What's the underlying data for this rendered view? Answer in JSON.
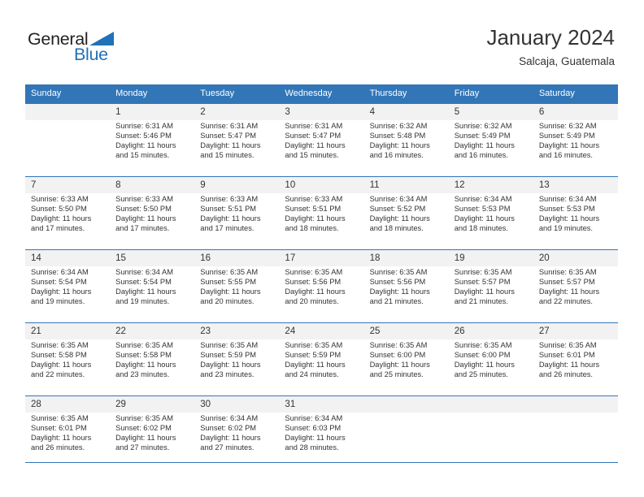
{
  "brand": {
    "name_top": "General",
    "name_bottom": "Blue",
    "accent_color": "#1f72b8"
  },
  "header": {
    "title": "January 2024",
    "subtitle": "Salcaja, Guatemala"
  },
  "calendar": {
    "header_bg": "#3276b8",
    "weekday_headers": [
      "Sunday",
      "Monday",
      "Tuesday",
      "Wednesday",
      "Thursday",
      "Friday",
      "Saturday"
    ],
    "weeks": [
      [
        {
          "day": "",
          "sunrise": "",
          "sunset": "",
          "daylight_line1": "",
          "daylight_line2": "",
          "empty": true
        },
        {
          "day": "1",
          "sunrise": "Sunrise: 6:31 AM",
          "sunset": "Sunset: 5:46 PM",
          "daylight_line1": "Daylight: 11 hours",
          "daylight_line2": "and 15 minutes.",
          "empty": false
        },
        {
          "day": "2",
          "sunrise": "Sunrise: 6:31 AM",
          "sunset": "Sunset: 5:47 PM",
          "daylight_line1": "Daylight: 11 hours",
          "daylight_line2": "and 15 minutes.",
          "empty": false
        },
        {
          "day": "3",
          "sunrise": "Sunrise: 6:31 AM",
          "sunset": "Sunset: 5:47 PM",
          "daylight_line1": "Daylight: 11 hours",
          "daylight_line2": "and 15 minutes.",
          "empty": false
        },
        {
          "day": "4",
          "sunrise": "Sunrise: 6:32 AM",
          "sunset": "Sunset: 5:48 PM",
          "daylight_line1": "Daylight: 11 hours",
          "daylight_line2": "and 16 minutes.",
          "empty": false
        },
        {
          "day": "5",
          "sunrise": "Sunrise: 6:32 AM",
          "sunset": "Sunset: 5:49 PM",
          "daylight_line1": "Daylight: 11 hours",
          "daylight_line2": "and 16 minutes.",
          "empty": false
        },
        {
          "day": "6",
          "sunrise": "Sunrise: 6:32 AM",
          "sunset": "Sunset: 5:49 PM",
          "daylight_line1": "Daylight: 11 hours",
          "daylight_line2": "and 16 minutes.",
          "empty": false
        }
      ],
      [
        {
          "day": "7",
          "sunrise": "Sunrise: 6:33 AM",
          "sunset": "Sunset: 5:50 PM",
          "daylight_line1": "Daylight: 11 hours",
          "daylight_line2": "and 17 minutes.",
          "empty": false
        },
        {
          "day": "8",
          "sunrise": "Sunrise: 6:33 AM",
          "sunset": "Sunset: 5:50 PM",
          "daylight_line1": "Daylight: 11 hours",
          "daylight_line2": "and 17 minutes.",
          "empty": false
        },
        {
          "day": "9",
          "sunrise": "Sunrise: 6:33 AM",
          "sunset": "Sunset: 5:51 PM",
          "daylight_line1": "Daylight: 11 hours",
          "daylight_line2": "and 17 minutes.",
          "empty": false
        },
        {
          "day": "10",
          "sunrise": "Sunrise: 6:33 AM",
          "sunset": "Sunset: 5:51 PM",
          "daylight_line1": "Daylight: 11 hours",
          "daylight_line2": "and 18 minutes.",
          "empty": false
        },
        {
          "day": "11",
          "sunrise": "Sunrise: 6:34 AM",
          "sunset": "Sunset: 5:52 PM",
          "daylight_line1": "Daylight: 11 hours",
          "daylight_line2": "and 18 minutes.",
          "empty": false
        },
        {
          "day": "12",
          "sunrise": "Sunrise: 6:34 AM",
          "sunset": "Sunset: 5:53 PM",
          "daylight_line1": "Daylight: 11 hours",
          "daylight_line2": "and 18 minutes.",
          "empty": false
        },
        {
          "day": "13",
          "sunrise": "Sunrise: 6:34 AM",
          "sunset": "Sunset: 5:53 PM",
          "daylight_line1": "Daylight: 11 hours",
          "daylight_line2": "and 19 minutes.",
          "empty": false
        }
      ],
      [
        {
          "day": "14",
          "sunrise": "Sunrise: 6:34 AM",
          "sunset": "Sunset: 5:54 PM",
          "daylight_line1": "Daylight: 11 hours",
          "daylight_line2": "and 19 minutes.",
          "empty": false
        },
        {
          "day": "15",
          "sunrise": "Sunrise: 6:34 AM",
          "sunset": "Sunset: 5:54 PM",
          "daylight_line1": "Daylight: 11 hours",
          "daylight_line2": "and 19 minutes.",
          "empty": false
        },
        {
          "day": "16",
          "sunrise": "Sunrise: 6:35 AM",
          "sunset": "Sunset: 5:55 PM",
          "daylight_line1": "Daylight: 11 hours",
          "daylight_line2": "and 20 minutes.",
          "empty": false
        },
        {
          "day": "17",
          "sunrise": "Sunrise: 6:35 AM",
          "sunset": "Sunset: 5:56 PM",
          "daylight_line1": "Daylight: 11 hours",
          "daylight_line2": "and 20 minutes.",
          "empty": false
        },
        {
          "day": "18",
          "sunrise": "Sunrise: 6:35 AM",
          "sunset": "Sunset: 5:56 PM",
          "daylight_line1": "Daylight: 11 hours",
          "daylight_line2": "and 21 minutes.",
          "empty": false
        },
        {
          "day": "19",
          "sunrise": "Sunrise: 6:35 AM",
          "sunset": "Sunset: 5:57 PM",
          "daylight_line1": "Daylight: 11 hours",
          "daylight_line2": "and 21 minutes.",
          "empty": false
        },
        {
          "day": "20",
          "sunrise": "Sunrise: 6:35 AM",
          "sunset": "Sunset: 5:57 PM",
          "daylight_line1": "Daylight: 11 hours",
          "daylight_line2": "and 22 minutes.",
          "empty": false
        }
      ],
      [
        {
          "day": "21",
          "sunrise": "Sunrise: 6:35 AM",
          "sunset": "Sunset: 5:58 PM",
          "daylight_line1": "Daylight: 11 hours",
          "daylight_line2": "and 22 minutes.",
          "empty": false
        },
        {
          "day": "22",
          "sunrise": "Sunrise: 6:35 AM",
          "sunset": "Sunset: 5:58 PM",
          "daylight_line1": "Daylight: 11 hours",
          "daylight_line2": "and 23 minutes.",
          "empty": false
        },
        {
          "day": "23",
          "sunrise": "Sunrise: 6:35 AM",
          "sunset": "Sunset: 5:59 PM",
          "daylight_line1": "Daylight: 11 hours",
          "daylight_line2": "and 23 minutes.",
          "empty": false
        },
        {
          "day": "24",
          "sunrise": "Sunrise: 6:35 AM",
          "sunset": "Sunset: 5:59 PM",
          "daylight_line1": "Daylight: 11 hours",
          "daylight_line2": "and 24 minutes.",
          "empty": false
        },
        {
          "day": "25",
          "sunrise": "Sunrise: 6:35 AM",
          "sunset": "Sunset: 6:00 PM",
          "daylight_line1": "Daylight: 11 hours",
          "daylight_line2": "and 25 minutes.",
          "empty": false
        },
        {
          "day": "26",
          "sunrise": "Sunrise: 6:35 AM",
          "sunset": "Sunset: 6:00 PM",
          "daylight_line1": "Daylight: 11 hours",
          "daylight_line2": "and 25 minutes.",
          "empty": false
        },
        {
          "day": "27",
          "sunrise": "Sunrise: 6:35 AM",
          "sunset": "Sunset: 6:01 PM",
          "daylight_line1": "Daylight: 11 hours",
          "daylight_line2": "and 26 minutes.",
          "empty": false
        }
      ],
      [
        {
          "day": "28",
          "sunrise": "Sunrise: 6:35 AM",
          "sunset": "Sunset: 6:01 PM",
          "daylight_line1": "Daylight: 11 hours",
          "daylight_line2": "and 26 minutes.",
          "empty": false
        },
        {
          "day": "29",
          "sunrise": "Sunrise: 6:35 AM",
          "sunset": "Sunset: 6:02 PM",
          "daylight_line1": "Daylight: 11 hours",
          "daylight_line2": "and 27 minutes.",
          "empty": false
        },
        {
          "day": "30",
          "sunrise": "Sunrise: 6:34 AM",
          "sunset": "Sunset: 6:02 PM",
          "daylight_line1": "Daylight: 11 hours",
          "daylight_line2": "and 27 minutes.",
          "empty": false
        },
        {
          "day": "31",
          "sunrise": "Sunrise: 6:34 AM",
          "sunset": "Sunset: 6:03 PM",
          "daylight_line1": "Daylight: 11 hours",
          "daylight_line2": "and 28 minutes.",
          "empty": false
        },
        {
          "day": "",
          "sunrise": "",
          "sunset": "",
          "daylight_line1": "",
          "daylight_line2": "",
          "empty": true
        },
        {
          "day": "",
          "sunrise": "",
          "sunset": "",
          "daylight_line1": "",
          "daylight_line2": "",
          "empty": true
        },
        {
          "day": "",
          "sunrise": "",
          "sunset": "",
          "daylight_line1": "",
          "daylight_line2": "",
          "empty": true
        }
      ]
    ]
  }
}
